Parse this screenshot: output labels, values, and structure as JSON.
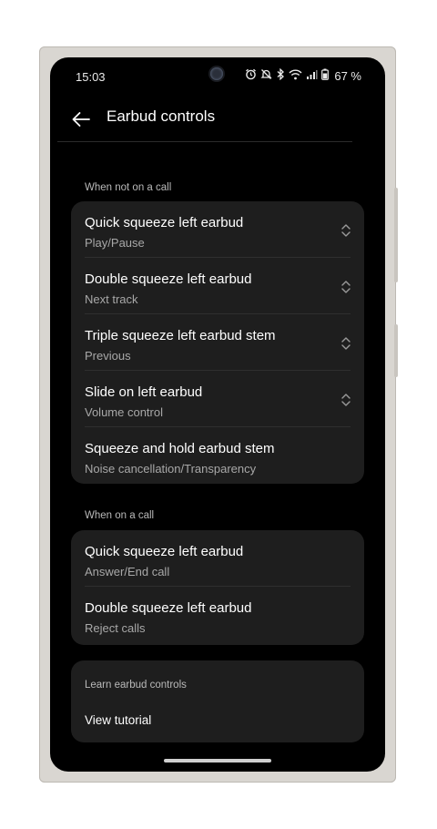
{
  "status_bar": {
    "time": "15:03",
    "battery": "67 %",
    "icons": [
      "alarm-icon",
      "mute-icon",
      "bluetooth-icon",
      "wifi-icon",
      "signal-icon",
      "battery-icon"
    ]
  },
  "header": {
    "title": "Earbud controls",
    "back_icon": "arrow-left-icon"
  },
  "sections": {
    "not_on_call": {
      "label": "When not on a call",
      "items": [
        {
          "title": "Quick squeeze left earbud",
          "subtitle": "Play/Pause"
        },
        {
          "title": "Double squeeze left earbud",
          "subtitle": "Next track"
        },
        {
          "title": "Triple squeeze left earbud stem",
          "subtitle": "Previous"
        },
        {
          "title": "Slide on left earbud",
          "subtitle": "Volume control"
        },
        {
          "title": "Squeeze and hold earbud stem",
          "subtitle": "Noise cancellation/Transparency"
        }
      ]
    },
    "on_call": {
      "label": "When on a call",
      "items": [
        {
          "title": "Quick squeeze left earbud",
          "subtitle": "Answer/End call"
        },
        {
          "title": "Double squeeze left earbud",
          "subtitle": "Reject calls"
        }
      ]
    },
    "learn": {
      "label": "Learn earbud controls",
      "link": "View tutorial"
    }
  },
  "colors": {
    "background": "#000000",
    "card": "#1e1e1e",
    "text_primary": "#ffffff",
    "text_secondary": "#a8a8a8"
  }
}
